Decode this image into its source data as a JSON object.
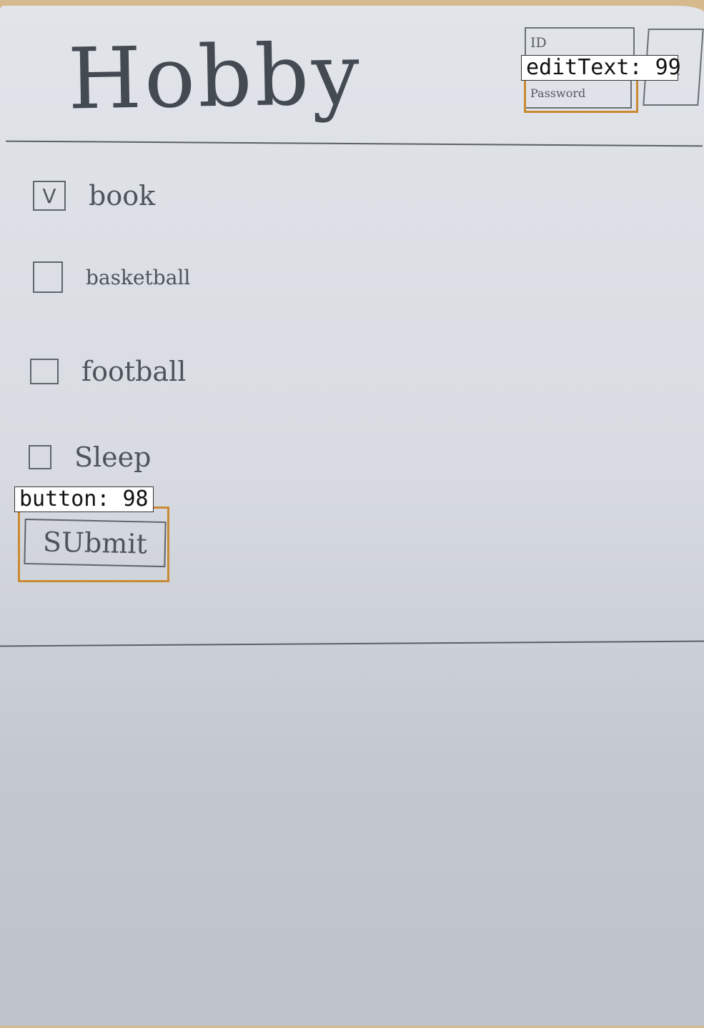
{
  "header": {
    "title": "Hobby",
    "id_field_placeholder": "ID",
    "password_field_placeholder": "Password",
    "side_button_label": "n"
  },
  "hobbies": [
    {
      "label": "book",
      "checked": true,
      "mark": "V"
    },
    {
      "label": "basketball",
      "checked": false,
      "mark": ""
    },
    {
      "label": "football",
      "checked": false,
      "mark": ""
    },
    {
      "label": "Sleep",
      "checked": false,
      "mark": ""
    }
  ],
  "submit_label": "SUbmit",
  "annotations": {
    "edittext_tag": "editText: 99",
    "button_tag": "button: 98"
  },
  "colors": {
    "paper": "#dde0e6",
    "ink": "#4e545c",
    "annotation_outline": "#c98a33"
  }
}
